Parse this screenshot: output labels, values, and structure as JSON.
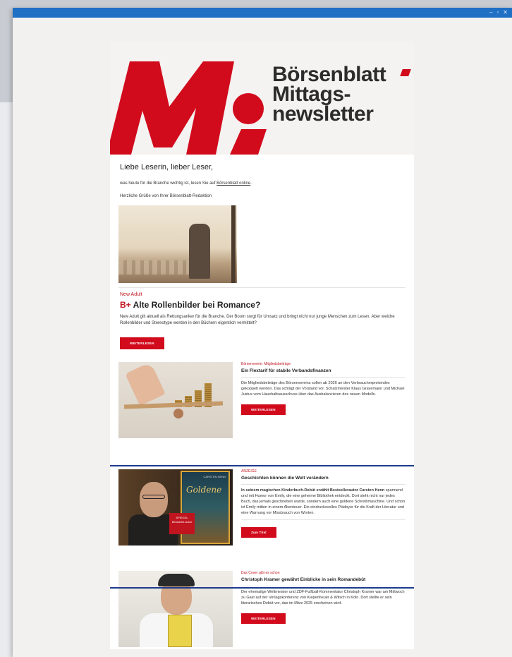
{
  "window": {
    "controls": [
      "–",
      "▫",
      "✕"
    ]
  },
  "newsletter": {
    "brand_lines": [
      "Börsenblatt",
      "Mittags-",
      "newsletter"
    ],
    "greeting": "Liebe Leserin, lieber Leser,",
    "intro_text": "was heute für die Branche wichtig ist, lesen Sie auf",
    "intro_link": "Börsenblatt online",
    "intro_end": ".",
    "regards": "Herzliche Grüße von Ihrer Börsenblatt-Redaktion",
    "lead_article": {
      "kicker": "New Adult",
      "plus_badge": "B+",
      "headline": "Alte Rollenbilder bei Romance?",
      "body": "New Adult gilt aktuell als Rettungsanker für die Branche. Der Boom sorgt für Umsatz und bringt nicht nur junge Menschen zum Lesen. Aber welche Rollenbilder und Stereotype werden in den Büchern eigentlich vermittelt?",
      "button": "WEITERLESEN"
    },
    "articles": [
      {
        "kicker": "Börsenverein: Mitgliedsbeiträge",
        "headline": "Ein Flextarif für stabile Verbandsfinanzen",
        "body": "Die Mitgliedsbeiträge des Börsenvereins sollen ab 2026 an den Verbraucherpreisindex gekoppelt werden. Das schlägt der Vorstand vor. Schatzmeister Klaus Gravemann und Michael Justus vom Haushaltsausschuss über das Ausbalancieren des neuen Modells.",
        "button": "WEITERLESEN"
      },
      {
        "kicker": "ANZEIGE",
        "headline": "Geschichten können die Welt verändern",
        "body_bold": "In seinem magischen Kinderbuch-Debüt erzählt Bestsellerautor Carsten Henn",
        "body": " spannend und mit Humor von Emily, die eine geheime Bibliothek entdeckt. Dort steht nicht nur jedes Buch, das jemals geschrieben wurde, sondern auch eine goldene Schreibmaschine. Und schon ist Emily mitten in einem Abenteuer. Ein eindrucksvolles Plädoyer für die Kraft der Literatur und eine Warnung vor Missbrauch von Worten.",
        "button": "Zum Titel",
        "book_title": "Goldene",
        "book_author": "CARSTEN HENN",
        "sticker": "SPIEGEL Bestseller-Autor"
      },
      {
        "kicker": "Das Cover gibt es schon",
        "headline": "Christoph Kramer gewährt Einblicke in sein Romandebüt",
        "body": "Der ehemalige Weltmeister und ZDF-Fußball-Kommentator Christoph Kramer war am Mittwoch zu Gast auf der Verlagskonferenz von Kiepenheuer & Witsch in Köln. Dort stellte er sein literarisches Debüt vor, das im März 2025 erscheinen wird.",
        "button": "WEITERLESEN"
      }
    ]
  },
  "colors": {
    "accent_red": "#d10a1c",
    "titlebar_blue": "#1f6fc5",
    "ad_frame": "#1d3a8c"
  }
}
